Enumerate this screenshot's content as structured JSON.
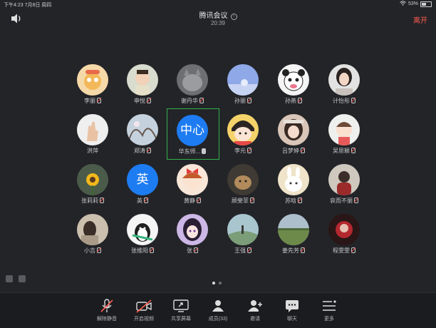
{
  "status_bar": {
    "time": "下午4:23  7月8日 周四",
    "battery": "53%"
  },
  "header": {
    "title": "腾讯会议",
    "timer": "20:39",
    "leave": "离开"
  },
  "participants": [
    {
      "name": "李丽",
      "mic": "muted",
      "avatar": "cartoon-yellow"
    },
    {
      "name": "申悦",
      "mic": "muted",
      "avatar": "photo-child"
    },
    {
      "name": "谢丹华",
      "mic": "muted",
      "avatar": "photo-cat"
    },
    {
      "name": "孙丽",
      "mic": "muted",
      "avatar": "photo-blue"
    },
    {
      "name": "孙燕",
      "mic": "muted",
      "avatar": "cartoon-panda"
    },
    {
      "name": "计怡彤",
      "mic": "muted",
      "avatar": "photo-woman"
    },
    {
      "name": "洪萍",
      "mic": "none",
      "avatar": "photo-hand"
    },
    {
      "name": "郑涛",
      "mic": "muted",
      "avatar": "photo-sky"
    },
    {
      "name": "华东师...",
      "mic": "on",
      "avatar_text": "中心",
      "active": true
    },
    {
      "name": "李元",
      "mic": "muted",
      "avatar": "cartoon-maruko"
    },
    {
      "name": "吕梦婷",
      "mic": "muted",
      "avatar": "photo-girl"
    },
    {
      "name": "吴思颖",
      "mic": "muted",
      "avatar": "cartoon-kid"
    },
    {
      "name": "张莉莉",
      "mic": "muted",
      "avatar": "photo-sunflower"
    },
    {
      "name": "英",
      "mic": "muted",
      "avatar_text": "英"
    },
    {
      "name": "黄静",
      "mic": "muted",
      "avatar": "cartoon-bow"
    },
    {
      "name": "顾斐菲",
      "mic": "muted",
      "avatar": "photo-cat2"
    },
    {
      "name": "苏晗",
      "mic": "muted",
      "avatar": "cartoon-bunny"
    },
    {
      "name": "哀而不丽",
      "mic": "muted",
      "avatar": "photo-dark"
    },
    {
      "name": "小吉",
      "mic": "muted",
      "avatar": "photo-beige"
    },
    {
      "name": "张维阳",
      "mic": "muted",
      "avatar": "cartoon-penguin"
    },
    {
      "name": "张",
      "mic": "muted",
      "avatar": "cartoon-purple"
    },
    {
      "name": "王强",
      "mic": "muted",
      "avatar": "photo-sea"
    },
    {
      "name": "姜先芳",
      "mic": "muted",
      "avatar": "photo-field"
    },
    {
      "name": "程雯雯",
      "mic": "muted",
      "avatar": "photo-red"
    }
  ],
  "toolbar": [
    {
      "label": "解除静音",
      "icon": "mic-off-icon"
    },
    {
      "label": "开启视频",
      "icon": "video-off-icon"
    },
    {
      "label": "共享屏幕",
      "icon": "share-screen-icon"
    },
    {
      "label": "成员(33)",
      "icon": "members-icon"
    },
    {
      "label": "邀请",
      "icon": "invite-icon"
    },
    {
      "label": "聊天",
      "icon": "chat-icon"
    },
    {
      "label": "更多",
      "icon": "more-icon"
    }
  ],
  "colors": {
    "accent": "#1e7cf2",
    "leave": "#ff5b4f",
    "active_border": "#2fb24a",
    "background": "#232428"
  }
}
